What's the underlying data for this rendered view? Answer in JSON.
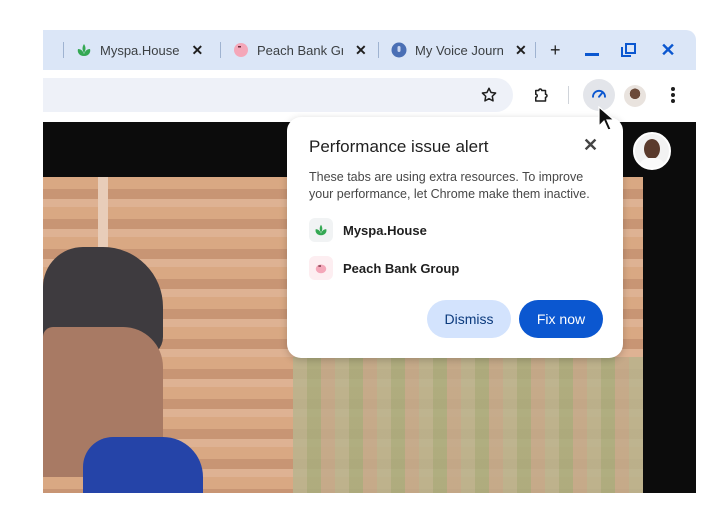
{
  "tabs": [
    {
      "title": "Myspa.House",
      "icon": "leaf-icon",
      "color": "#34a853"
    },
    {
      "title": "Peach Bank Gr",
      "icon": "piggy-bank-icon",
      "color": "#f4a7b9"
    },
    {
      "title": "My Voice Journ",
      "icon": "microphone-icon",
      "color": "#4a6fb5"
    }
  ],
  "window_controls": {
    "new_tab": "+",
    "minimize": "–",
    "restore": "⧉",
    "close": "✕"
  },
  "toolbar": {
    "bookmark_icon": "star-icon",
    "extensions_icon": "puzzle-icon",
    "performance_icon": "speedometer-icon",
    "menu_icon": "more-vert-icon"
  },
  "popup": {
    "title": "Performance issue alert",
    "description": "These tabs are using extra resources. To improve your performance, let Chrome make them inactive.",
    "sites": [
      {
        "name": "Myspa.House",
        "icon": "leaf-icon"
      },
      {
        "name": "Peach Bank Group",
        "icon": "piggy-bank-icon"
      }
    ],
    "dismiss_label": "Dismiss",
    "fix_label": "Fix now"
  },
  "colors": {
    "accent": "#0b57d0",
    "tabstrip": "#dbe6f7",
    "dismiss_bg": "#d3e3fd"
  }
}
